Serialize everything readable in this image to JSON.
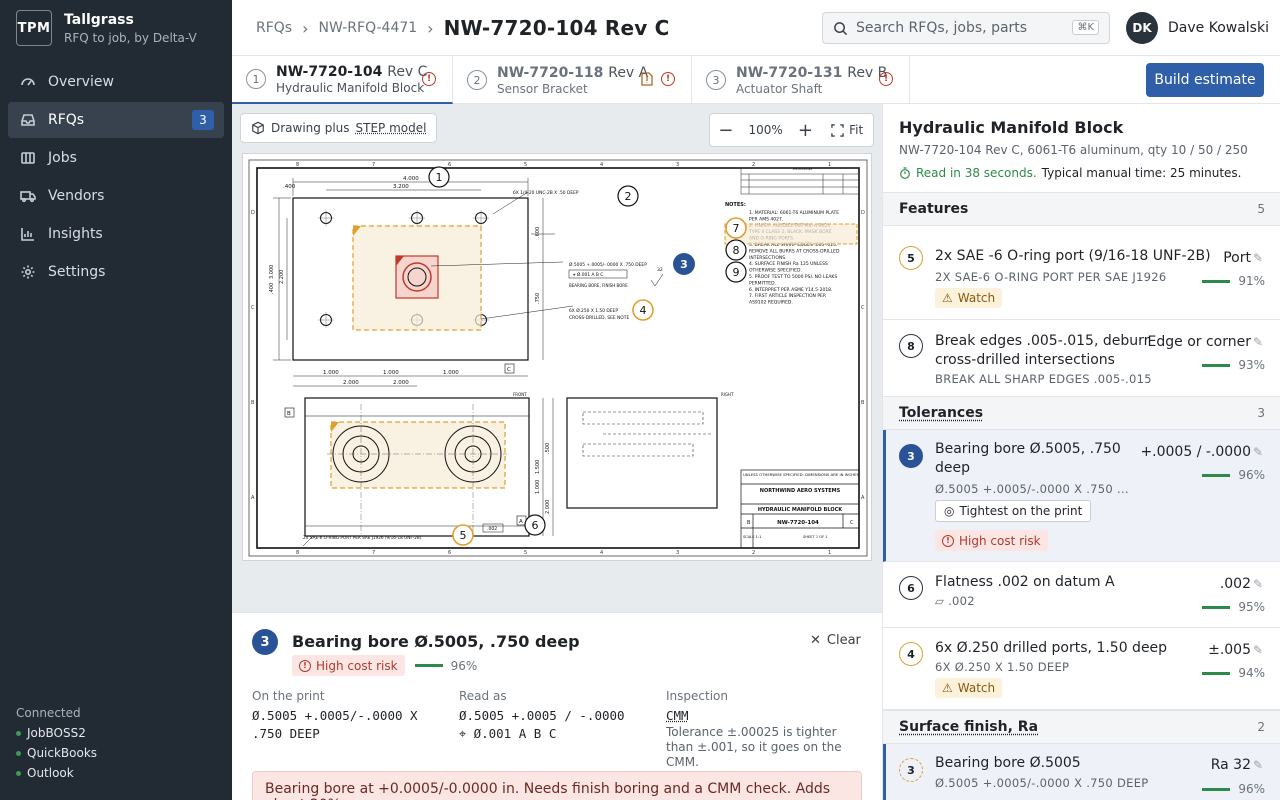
{
  "brand": {
    "logo": "TPM",
    "name": "Tallgrass",
    "tagline": "RFQ to job, by Delta-V"
  },
  "nav": [
    {
      "label": "Overview",
      "icon": "overview-icon"
    },
    {
      "label": "RFQs",
      "icon": "inbox-icon",
      "badge": "3",
      "active": true
    },
    {
      "label": "Jobs",
      "icon": "jobs-icon"
    },
    {
      "label": "Vendors",
      "icon": "truck-icon"
    },
    {
      "label": "Insights",
      "icon": "chart-icon"
    },
    {
      "label": "Settings",
      "icon": "gear-icon"
    }
  ],
  "connected": {
    "title": "Connected",
    "items": [
      "JobBOSS2",
      "QuickBooks",
      "Outlook"
    ]
  },
  "breadcrumb": {
    "root": "RFQs",
    "rfq": "NW-RFQ-4471",
    "current": "NW-7720-104 Rev C"
  },
  "search": {
    "placeholder": "Search RFQs, jobs, parts",
    "shortcut": "⌘K"
  },
  "user": {
    "initials": "DK",
    "name": "Dave Kowalski"
  },
  "tabs": [
    {
      "num": "1",
      "part": "NW-7720-104",
      "rev": "Rev C",
      "name": "Hydraulic Manifold Block"
    },
    {
      "num": "2",
      "part": "NW-7720-118",
      "rev": "Rev A",
      "name": "Sensor Bracket"
    },
    {
      "num": "3",
      "part": "NW-7720-131",
      "rev": "Rev B",
      "name": "Actuator Shaft"
    }
  ],
  "actions": {
    "build": "Build estimate"
  },
  "viewer": {
    "source_label": "Drawing plus",
    "source_link": "STEP model",
    "zoom": "100%",
    "fit": "Fit"
  },
  "drawing": {
    "dims_top": [
      "4.000",
      ".400",
      "3.200",
      "1.000",
      "1.000",
      "1.000",
      "2.000",
      "2.000"
    ],
    "dims_side": [
      "3.000",
      "2.200",
      ".600",
      ".400",
      ".750",
      "1.500",
      ".500",
      "1.000",
      "2.000"
    ],
    "callout_2": "6X 1/4-20 UNC-2B X .50 DEEP",
    "callout_3": "Ø.5005 +.0005/-.0000 X .750 DEEP",
    "callout_3b": "BEARING BORE, FINISH BORE",
    "callout_fcf": "⌖ Ø.001 A B C",
    "callout_4": "6X Ø.250 X 1.50 DEEP",
    "callout_4b": "CROSS-DRILLED, SEE NOTE",
    "callout_5": "2X SAE-6 O-RING PORT PER SAE J1926 (9/16-18 UNF-2B)",
    "callout_6": ".002",
    "label_front": "FRONT",
    "label_right": "RIGHT",
    "ra": "32",
    "notes_title": "NOTES:",
    "notes": [
      "1. MATERIAL: 6061-T6 ALUMINUM PLATE",
      "   PER AMS 4027.",
      "2. FINISH: ANODIZE PER MIL-A-8625",
      "   TYPE II CLASS 2, BLACK. MASK BORE",
      "   AND O-RING PORTS.",
      "3. BREAK ALL SHARP EDGES .005-.015.",
      "   REMOVE ALL BURRS AT CROSS-DRILLED",
      "   INTERSECTIONS.",
      "4. SURFACE FINISH Ra 125 UNLESS",
      "   OTHERWISE SPECIFIED.",
      "5. PROOF TEST TO 5000 PSI. NO LEAKS",
      "   PERMITTED.",
      "6. INTERPRET PER ASME Y14.5-2018.",
      "7. FIRST ARTICLE INSPECTION PER",
      "   AS9102 REQUIRED."
    ],
    "tb_tol": "UNLESS OTHERWISE SPECIFIED: DIMENSIONS ARE IN INCHES",
    "tb_company": "NORTHWIND AERO SYSTEMS",
    "tb_title": "HYDRAULIC MANIFOLD BLOCK",
    "tb_dwg": "NW-7720-104",
    "tb_size": "B",
    "tb_rev": "C",
    "tb_scale": "SCALE 1:1",
    "tb_sheet": "SHEET 1 OF 1",
    "rev_header": "REVISIONS",
    "grid_top": [
      "8",
      "7",
      "6",
      "5",
      "4",
      "3",
      "2",
      "1"
    ],
    "grid_side": [
      "D",
      "C",
      "B",
      "A"
    ],
    "datum_a": "A",
    "datum_b": "B",
    "datum_c": "C"
  },
  "detail": {
    "num": "3",
    "title": "Bearing bore Ø.5005, .750 deep",
    "risk": "High cost risk",
    "confidence": "96%",
    "clear": "Clear",
    "on_print_label": "On the print",
    "on_print_1": "Ø.5005 +.0005/-.0000 X",
    "on_print_2": ".750 DEEP",
    "read_as_label": "Read as",
    "read_as_1": "Ø.5005 +.0005 / -.0000",
    "read_as_2": "⌖ Ø.001 A B C",
    "inspection_label": "Inspection",
    "inspection": "CMM",
    "inspection_note": "Tolerance ±.00025 is tighter than ±.001, so it goes on the CMM.",
    "cost_note": "Bearing bore at +0.0005/-0.0000 in. Needs finish boring and a CMM check. Adds about 20%"
  },
  "summary": {
    "title": "Hydraulic Manifold Block",
    "subtitle": "NW-7720-104 Rev C, 6061-T6 aluminum, qty 10 / 50 / 250",
    "read_time": "Read in 38 seconds.",
    "manual_time": "Typical manual time: 25 minutes."
  },
  "sections": {
    "features": {
      "title": "Features",
      "count": "5"
    },
    "tolerances": {
      "title": "Tolerances",
      "count": "3"
    },
    "surface": {
      "title": "Surface finish, Ra",
      "count": "2"
    }
  },
  "features": [
    {
      "num": "5",
      "title": "2x SAE -6 O-ring port (9/16-18 UNF-2B)",
      "raw": "2X SAE-6 O-RING PORT PER SAE J1926",
      "type": "Port",
      "confidence": "91%",
      "watch": "Watch"
    },
    {
      "num": "8",
      "title_1": "Break edges .005-.015, deburr",
      "title_2": "cross-drilled intersections",
      "raw": "BREAK ALL SHARP EDGES .005-.015",
      "type": "Edge or corner",
      "confidence": "93%"
    }
  ],
  "tolerances": [
    {
      "num": "3",
      "title_1": "Bearing bore Ø.5005, .750",
      "title_2": "deep",
      "raw": "Ø.5005 +.0005/-.0000 X .750 ...",
      "value": "+.0005 / -.0000",
      "confidence": "96%",
      "tightest": "Tightest on the print",
      "risk": "High cost risk"
    },
    {
      "num": "6",
      "title": "Flatness .002 on datum A",
      "raw": "▱ .002",
      "value": ".002",
      "confidence": "95%"
    },
    {
      "num": "4",
      "title": "6x Ø.250 drilled ports, 1.50 deep",
      "raw": "6X Ø.250 X 1.50 DEEP",
      "value": "±.005",
      "confidence": "94%",
      "watch": "Watch"
    }
  ],
  "surface": [
    {
      "num": "3",
      "title": "Bearing bore Ø.5005",
      "raw": "Ø.5005 +.0005/-.0000 X .750 DEEP",
      "value": "Ra 32",
      "confidence": "96%"
    }
  ],
  "colors": {
    "sidebar": "#222a33",
    "accent": "#2f5fa8",
    "risk": "#b03a2e",
    "watch": "#e0a030",
    "ok": "#2d8b4a"
  }
}
